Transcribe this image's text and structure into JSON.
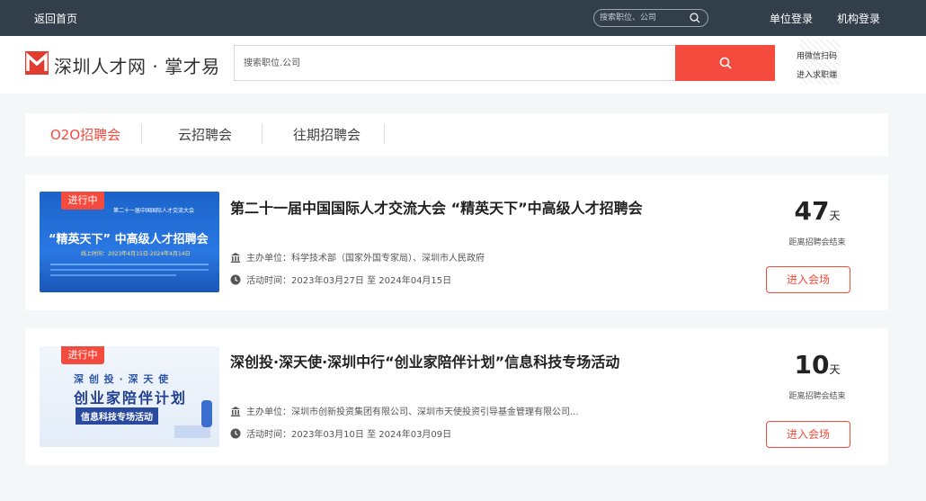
{
  "topbar": {
    "home_label": "返回首页",
    "search_placeholder": "搜索职位、公司",
    "unit_login": "单位登录",
    "org_login": "机构登录"
  },
  "header": {
    "logo_text": "深圳人才网 · 掌才易",
    "search_placeholder": "搜索职位.公司",
    "qr_line1": "用微信扫码",
    "qr_line2": "进入求职端"
  },
  "tabs": [
    "O2O招聘会",
    "云招聘会",
    "往期招聘会"
  ],
  "fairs": [
    {
      "status": "进行中",
      "title": "第二十一届中国国际人才交流大会 “精英天下”中高级人才招聘会",
      "organizer": "主办单位：科学技术部（国家外国专家局）、深圳市人民政府",
      "time": "活动时间：2023年03月27日 至 2024年04月15日",
      "days": "47",
      "days_unit": "天",
      "days_caption": "距离招聘会结束",
      "enter_label": "进入会场",
      "poster": {
        "line1": "第二十一届中国国际人才交流大会",
        "line2": "“精英天下” 中高级人才招聘会",
        "line3": "线上时间：2023年4月15日-2024年4月14日"
      }
    },
    {
      "status": "进行中",
      "title": "深创投·深天使·深圳中行“创业家陪伴计划”信息科技专场活动",
      "organizer": "主办单位：深圳市创新投资集团有限公司、深圳市天使投资引导基金管理有限公司...",
      "time": "活动时间：2023年03月10日 至 2024年03月09日",
      "days": "10",
      "days_unit": "天",
      "days_caption": "距离招聘会结束",
      "enter_label": "进入会场",
      "poster": {
        "line1": "深 创 投 · 深 天 使",
        "line2": "创业家陪伴计划",
        "line3": "信息科技专场活动"
      }
    }
  ],
  "colors": {
    "accent": "#f44b3e",
    "topbar": "#333e4b",
    "page_bg": "#f5f6f8"
  }
}
